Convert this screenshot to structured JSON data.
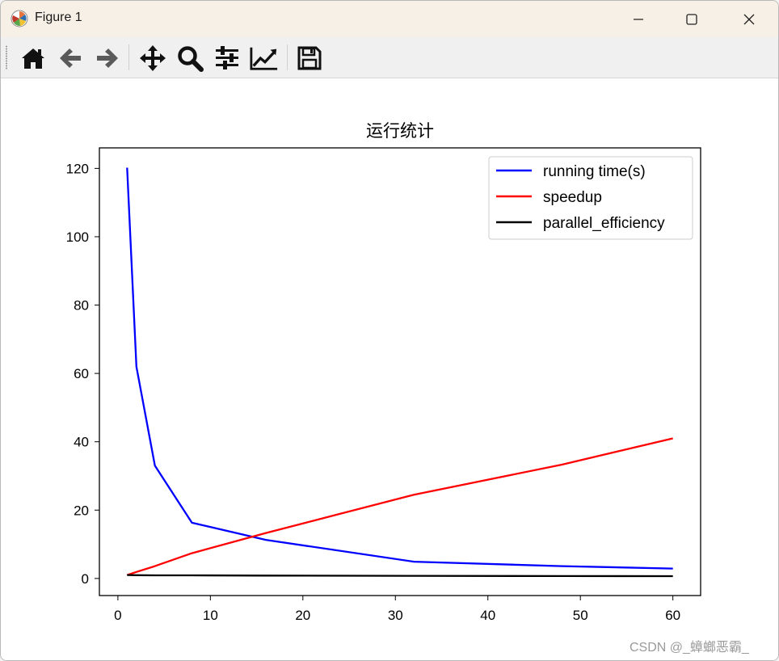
{
  "window": {
    "title": "Figure 1"
  },
  "toolbar": {
    "items": [
      {
        "name": "home-icon"
      },
      {
        "name": "back-arrow-icon"
      },
      {
        "name": "forward-arrow-icon"
      },
      {
        "name": "pan-move-icon"
      },
      {
        "name": "zoom-magnifier-icon"
      },
      {
        "name": "configure-subplots-icon"
      },
      {
        "name": "edit-axis-curve-icon"
      },
      {
        "name": "save-floppy-icon"
      }
    ]
  },
  "watermark": "CSDN @_蟑螂恶霸_",
  "chart_data": {
    "type": "line",
    "title": "运行统计",
    "xlabel": "",
    "ylabel": "",
    "xlim": [
      -2.0,
      63.0
    ],
    "ylim": [
      -5.0,
      126.0
    ],
    "xticks": [
      0,
      10,
      20,
      30,
      40,
      50,
      60
    ],
    "yticks": [
      0,
      20,
      40,
      60,
      80,
      100,
      120
    ],
    "grid": false,
    "legend_position": "top-right",
    "series": [
      {
        "name": "running time(s)",
        "color": "#0000ff",
        "x": [
          1,
          2,
          4,
          8,
          16,
          32,
          48,
          60
        ],
        "y": [
          120.2,
          62.0,
          33.0,
          16.3,
          11.3,
          4.9,
          3.6,
          2.9
        ]
      },
      {
        "name": "speedup",
        "color": "#ff0000",
        "x": [
          1,
          2,
          4,
          8,
          16,
          32,
          48,
          60
        ],
        "y": [
          1.0,
          1.9,
          3.6,
          7.4,
          13.3,
          24.5,
          33.3,
          41.0
        ]
      },
      {
        "name": "parallel_efficiency",
        "color": "#000000",
        "x": [
          1,
          2,
          4,
          8,
          16,
          32,
          48,
          60
        ],
        "y": [
          1.0,
          0.97,
          0.91,
          0.92,
          0.83,
          0.77,
          0.69,
          0.68
        ]
      }
    ]
  }
}
